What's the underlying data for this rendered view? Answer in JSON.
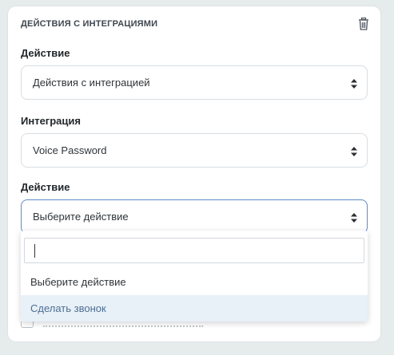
{
  "card": {
    "title": "ДЕЙСТВИЯ С ИНТЕГРАЦИЯМИ",
    "delete_icon": "trash-icon"
  },
  "fields": [
    {
      "label": "Действие",
      "value": "Действия с интеграцией"
    },
    {
      "label": "Интеграция",
      "value": "Voice Password"
    },
    {
      "label": "Действие",
      "value": "Выберите действие"
    }
  ],
  "dropdown": {
    "search_value": "",
    "options": [
      {
        "label": "Выберите действие",
        "highlighted": false
      },
      {
        "label": "Сделать звонок",
        "highlighted": true
      }
    ]
  },
  "colors": {
    "page_bg": "#e6eceb",
    "focus_border": "#5b8cc7",
    "highlight_bg": "#e8f0f8"
  }
}
